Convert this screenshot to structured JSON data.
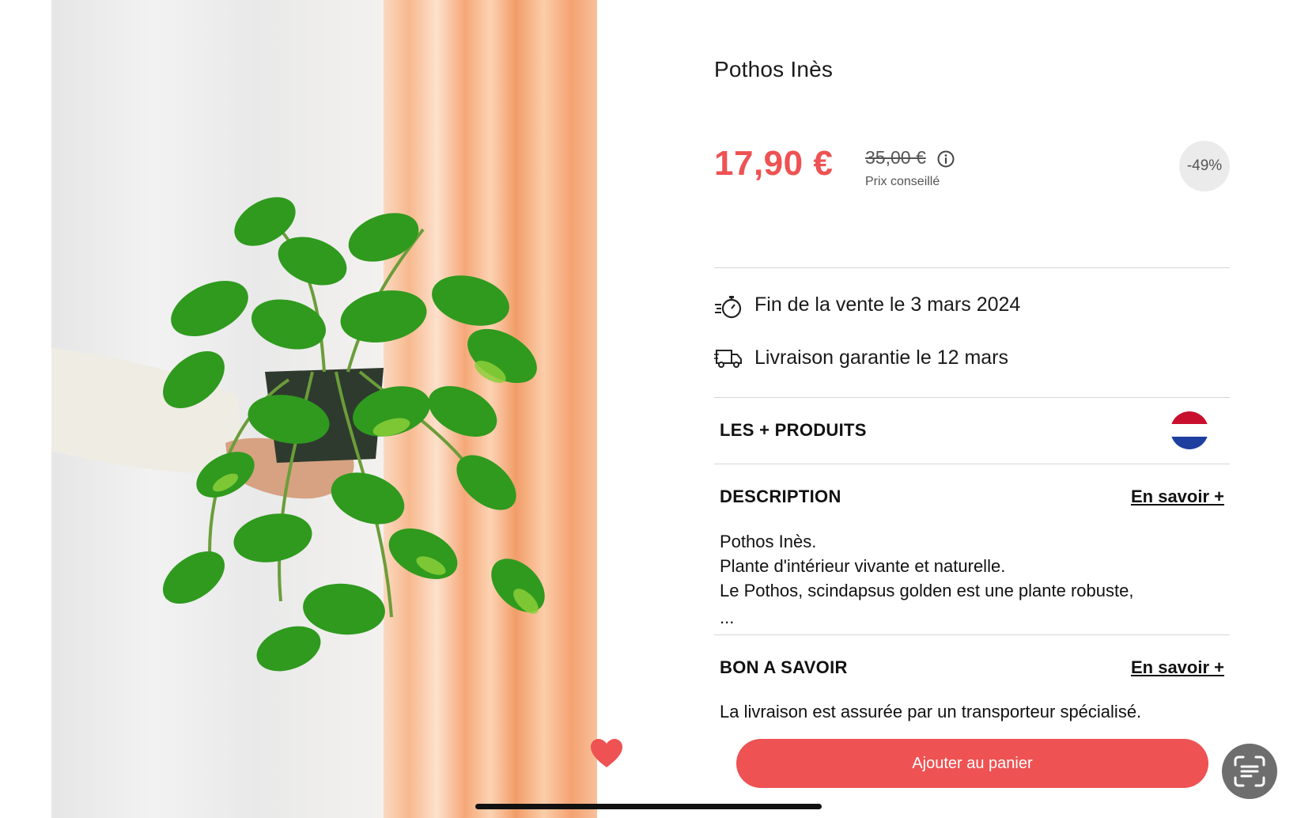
{
  "product": {
    "title": "Pothos Inès",
    "image_alt": "pothos-plant-photo"
  },
  "pricing": {
    "current_price": "17,90 €",
    "original_price": "35,00 €",
    "price_note": "Prix conseillé",
    "discount": "-49%",
    "accent_color": "#ee5253"
  },
  "info": {
    "sale_end": "Fin de la vente le 3 mars 2024",
    "delivery": "Livraison garantie le 12 mars"
  },
  "sections": {
    "products_plus": {
      "heading": "LES + PRODUITS",
      "flag_icon": "netherlands-flag-icon"
    },
    "description": {
      "heading": "DESCRIPTION",
      "learn_more": "En savoir +",
      "lines": [
        "Pothos Inès.",
        "Plante d'intérieur vivante et naturelle.",
        "Le Pothos, scindapsus golden est une plante robuste,",
        "..."
      ]
    },
    "good_to_know": {
      "heading": "BON A SAVOIR",
      "learn_more": "En savoir +",
      "text": "La livraison est assurée par un transporteur spécialisé."
    }
  },
  "actions": {
    "add_to_cart": "Ajouter au panier",
    "favorite_icon": "heart-icon",
    "scan_icon": "scan-text-icon"
  }
}
